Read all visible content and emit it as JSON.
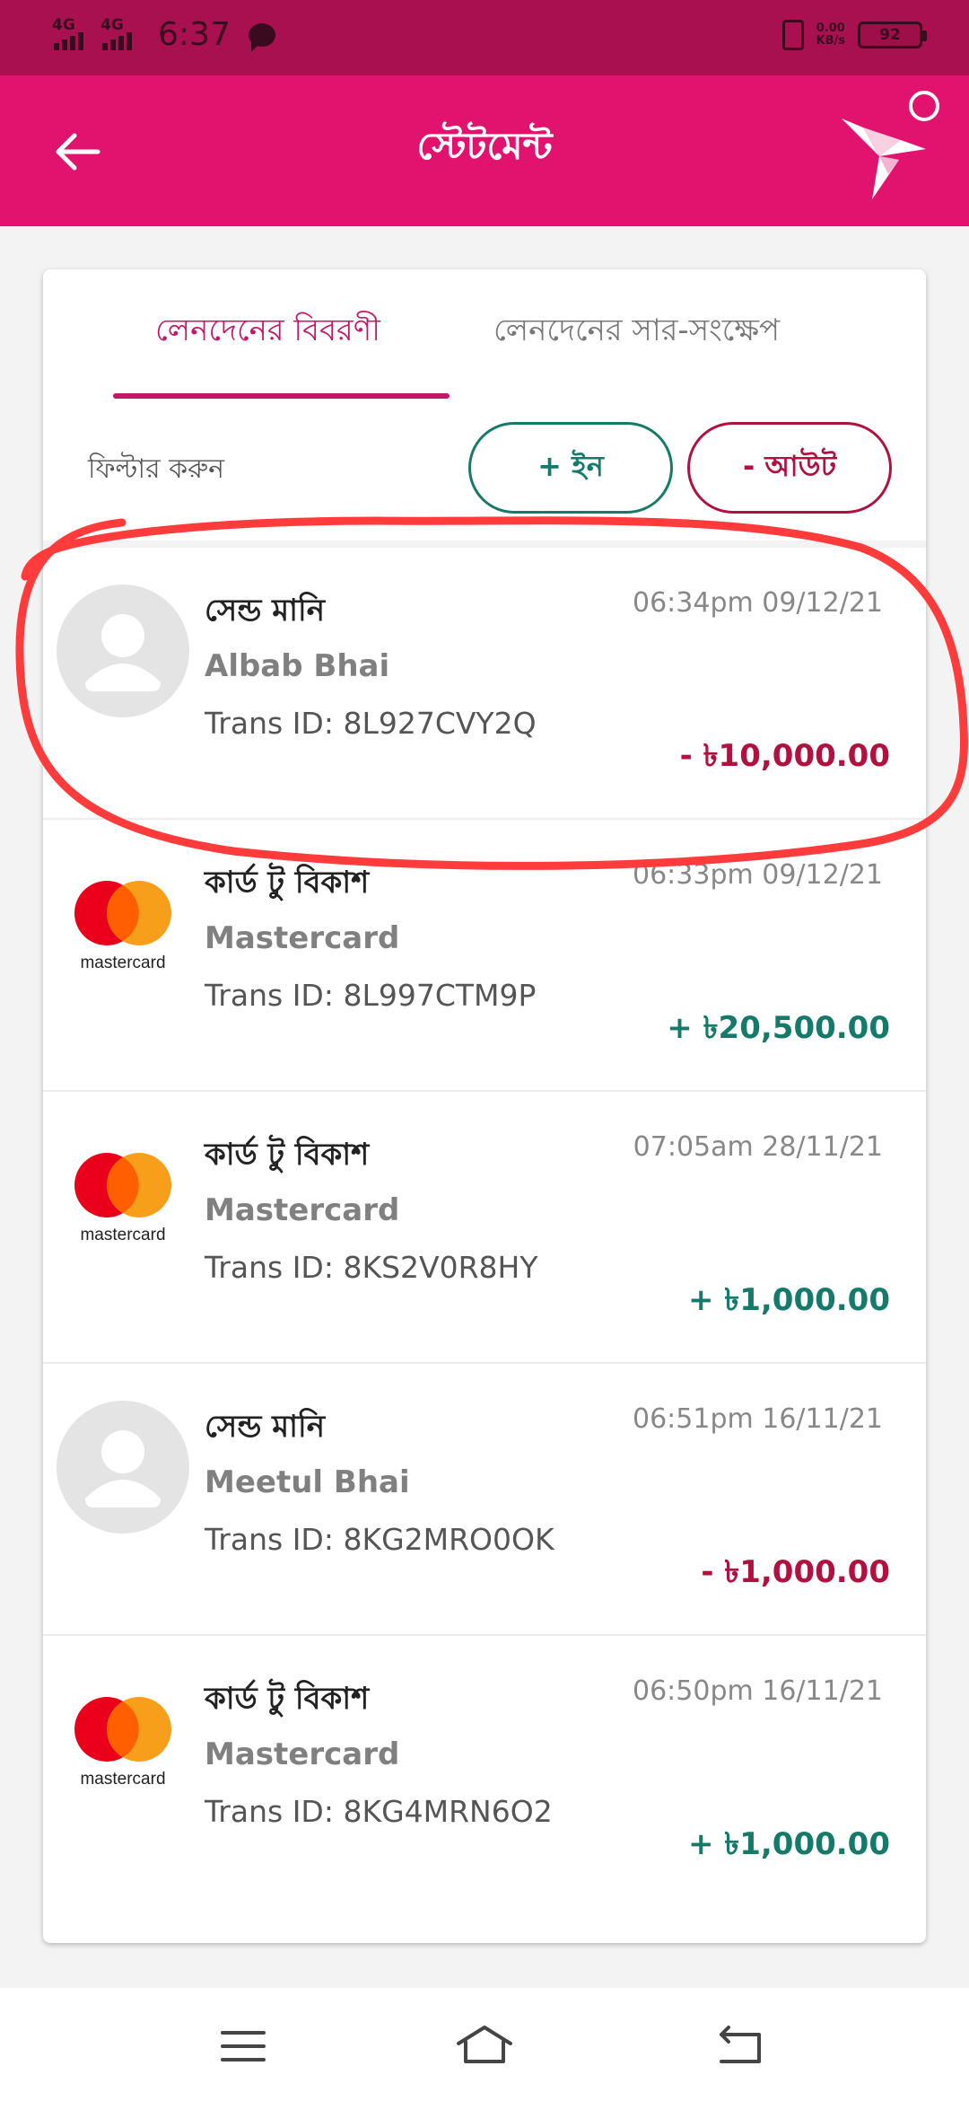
{
  "status_bar": {
    "network1": "4G",
    "network2": "4G",
    "time": "6:37",
    "speed_value": "0.00",
    "speed_unit": "KB/s",
    "battery": "92"
  },
  "header": {
    "title": "স্টেটমেন্ট"
  },
  "tabs": [
    {
      "label": "লেনদেনের বিবরণী",
      "active": true
    },
    {
      "label": "লেনদেনের সার-সংক্ষেপ",
      "active": false
    }
  ],
  "filter": {
    "label": "ফিল্টার করুন",
    "in_label": "+ ইন",
    "out_label": "- আউট"
  },
  "transactions": [
    {
      "type": "সেন্ড মানি",
      "name": "Albab Bhai",
      "trans_id": "Trans ID: 8L927CVY2Q",
      "time": "06:34pm 09/12/21",
      "amount": "- ৳10,000.00",
      "direction": "out",
      "icon": "person-avatar-icon"
    },
    {
      "type": "কার্ড টু বিকাশ",
      "name": "Mastercard",
      "trans_id": "Trans ID: 8L997CTM9P",
      "time": "06:33pm 09/12/21",
      "amount": "+ ৳20,500.00",
      "direction": "in",
      "icon": "mastercard-logo"
    },
    {
      "type": "কার্ড টু বিকাশ",
      "name": "Mastercard",
      "trans_id": "Trans ID: 8KS2V0R8HY",
      "time": "07:05am 28/11/21",
      "amount": "+ ৳1,000.00",
      "direction": "in",
      "icon": "mastercard-logo"
    },
    {
      "type": "সেন্ড মানি",
      "name": "Meetul Bhai",
      "trans_id": "Trans ID: 8KG2MRO0OK",
      "time": "06:51pm 16/11/21",
      "amount": "- ৳1,000.00",
      "direction": "out",
      "icon": "person-avatar-icon"
    },
    {
      "type": "কার্ড টু বিকাশ",
      "name": "Mastercard",
      "trans_id": "Trans ID: 8KG4MRN6O2",
      "time": "06:50pm 16/11/21",
      "amount": "+ ৳1,000.00",
      "direction": "in",
      "icon": "mastercard-logo"
    }
  ],
  "mastercard_wordmark": "mastercard",
  "colors": {
    "status_bar": "#a8104f",
    "brand": "#e2136e",
    "accent": "#c5166a",
    "positive": "#167a6a",
    "negative": "#b0113f",
    "annotation": "#ff3b3b"
  }
}
